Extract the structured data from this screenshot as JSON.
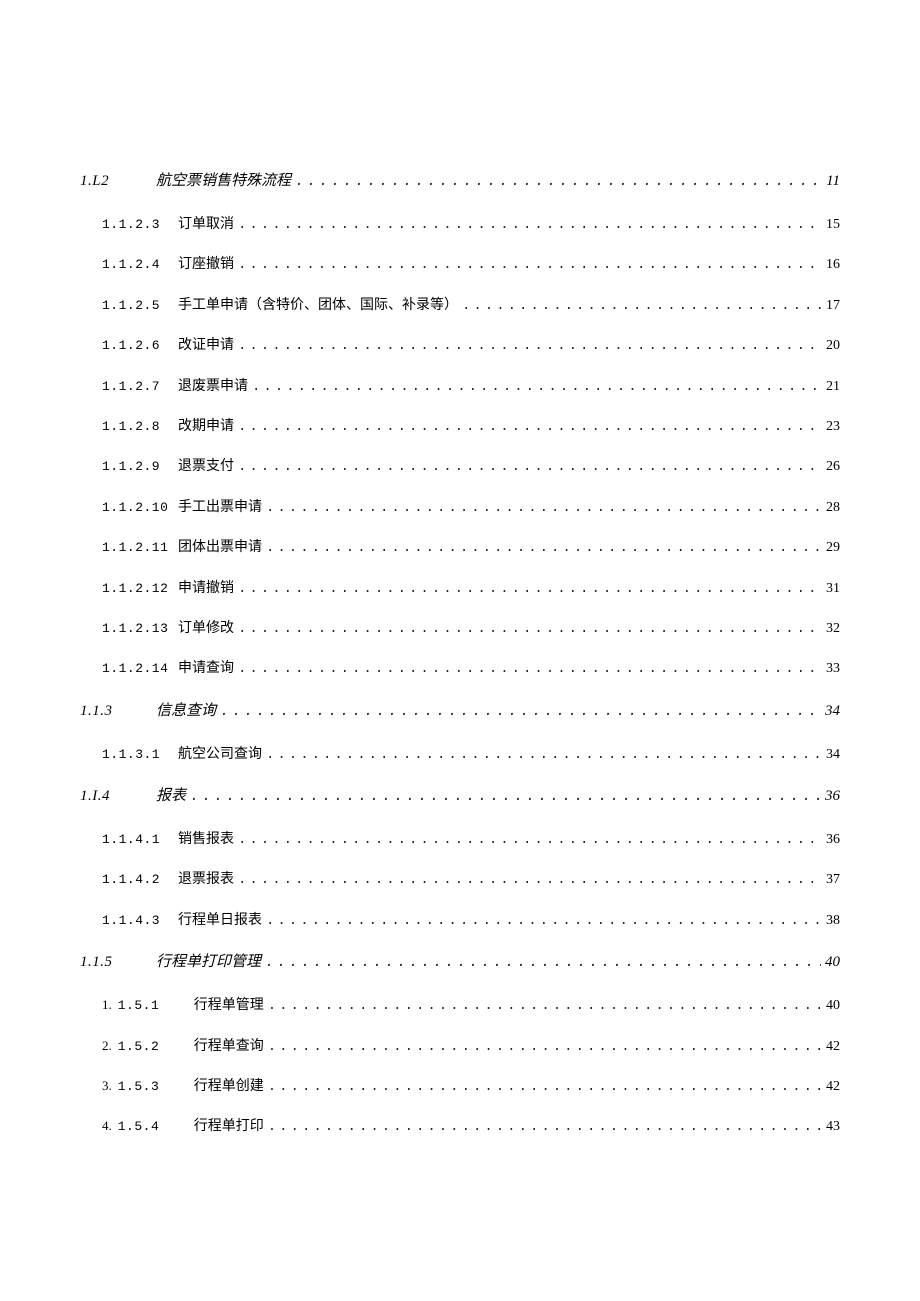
{
  "toc": [
    {
      "kind": "section",
      "num": "1.L2",
      "title": "航空票销售特殊流程",
      "page": "11",
      "indent": 0
    },
    {
      "kind": "item",
      "num": "1.1.2.3",
      "title": "订单取消",
      "page": "15",
      "indent": 1
    },
    {
      "kind": "item",
      "num": "1.1.2.4",
      "title": "订座撤销",
      "page": "16",
      "indent": 1
    },
    {
      "kind": "item",
      "num": "1.1.2.5",
      "title": "手工单申请（含特价、团体、国际、补录等）",
      "page": "17",
      "indent": 1
    },
    {
      "kind": "item",
      "num": "1.1.2.6",
      "title": "改证申请",
      "page": "20",
      "indent": 1
    },
    {
      "kind": "item",
      "num": "1.1.2.7",
      "title": "退废票申请",
      "page": "21",
      "indent": 1
    },
    {
      "kind": "item",
      "num": "1.1.2.8",
      "title": "改期申请",
      "page": "23",
      "indent": 1
    },
    {
      "kind": "item",
      "num": "1.1.2.9",
      "title": "退票支付",
      "page": "26",
      "indent": 1
    },
    {
      "kind": "item",
      "num": "1.1.2.10",
      "title": "手工出票申请",
      "page": "28",
      "indent": 1
    },
    {
      "kind": "item",
      "num": "1.1.2.11",
      "title": "团体出票申请",
      "page": "29",
      "indent": 1
    },
    {
      "kind": "item",
      "num": "1.1.2.12",
      "title": "申请撤销",
      "page": "31",
      "indent": 1
    },
    {
      "kind": "item",
      "num": "1.1.2.13",
      "title": "订单修改",
      "page": "32",
      "indent": 1
    },
    {
      "kind": "item",
      "num": "1.1.2.14",
      "title": "申请查询",
      "page": "33",
      "indent": 1
    },
    {
      "kind": "section",
      "num": "1.1.3",
      "title": "信息查询",
      "page": "34",
      "indent": 0
    },
    {
      "kind": "item",
      "num": "1.1.3.1",
      "title": "航空公司查询",
      "page": "34",
      "indent": 1
    },
    {
      "kind": "section",
      "num": "1.I.4",
      "title": "报表",
      "page": "36",
      "indent": 0
    },
    {
      "kind": "item",
      "num": "1.1.4.1",
      "title": "销售报表",
      "page": "36",
      "indent": 1
    },
    {
      "kind": "item",
      "num": "1.1.4.2",
      "title": "退票报表",
      "page": "37",
      "indent": 1
    },
    {
      "kind": "item",
      "num": "1.1.4.3",
      "title": "行程单日报表",
      "page": "38",
      "indent": 1
    },
    {
      "kind": "section",
      "num": "1.1.5",
      "title": "行程单打印管理",
      "page": "40",
      "indent": 0
    },
    {
      "kind": "item",
      "prefix": "1.",
      "num": "1.5.1",
      "title": "行程单管理",
      "page": "40",
      "indent": 1
    },
    {
      "kind": "item",
      "prefix": "2.",
      "num": "1.5.2",
      "title": "行程单查询",
      "page": "42",
      "indent": 1
    },
    {
      "kind": "item",
      "prefix": "3.",
      "num": "1.5.3",
      "title": "行程单创建",
      "page": "42",
      "indent": 1
    },
    {
      "kind": "item",
      "prefix": "4.",
      "num": "1.5.4",
      "title": "行程单打印",
      "page": "43",
      "indent": 1
    }
  ]
}
